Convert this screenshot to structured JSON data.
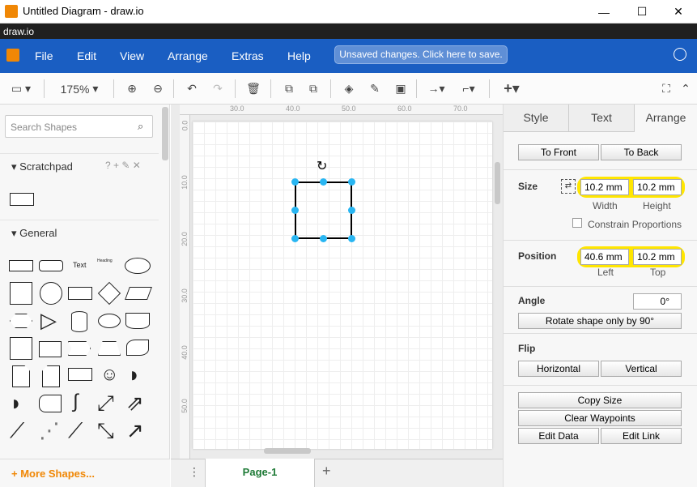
{
  "window": {
    "title": "Untitled Diagram - draw.io",
    "minimize": "—",
    "maximize": "☐",
    "close": "✕"
  },
  "namebar": "draw.io",
  "menu": {
    "file": "File",
    "edit": "Edit",
    "view": "View",
    "arrange": "Arrange",
    "extras": "Extras",
    "help": "Help",
    "unsaved": "Unsaved changes. Click here to save."
  },
  "toolbar": {
    "zoom": "175%"
  },
  "sidebar": {
    "search_placeholder": "Search Shapes",
    "scratchpad": "Scratchpad",
    "scratchpad_icons": "? + ✎ ✕",
    "general": "General",
    "shape_text": "Text",
    "shape_heading": "Heading",
    "more_shapes": "+ More Shapes..."
  },
  "ruler": {
    "top": [
      "30.0",
      "40.0",
      "50.0",
      "60.0",
      "70.0"
    ],
    "left": [
      "0.0",
      "10.0",
      "20.0",
      "30.0",
      "40.0",
      "50.0"
    ]
  },
  "pages": {
    "tab": "Page-1",
    "add": "+"
  },
  "panel": {
    "tabs": {
      "style": "Style",
      "text": "Text",
      "arrange": "Arrange"
    },
    "to_front": "To Front",
    "to_back": "To Back",
    "size_label": "Size",
    "width_value": "10.2 mm",
    "height_value": "10.2 mm",
    "width_label": "Width",
    "height_label": "Height",
    "constrain": "Constrain Proportions",
    "position_label": "Position",
    "left_value": "40.6 mm",
    "top_value": "10.2 mm",
    "left_label": "Left",
    "top_label": "Top",
    "angle_label": "Angle",
    "angle_value": "0°",
    "rotate": "Rotate shape only by 90°",
    "flip_label": "Flip",
    "horizontal": "Horizontal",
    "vertical": "Vertical",
    "copy_size": "Copy Size",
    "clear_waypoints": "Clear Waypoints",
    "edit_data": "Edit Data",
    "edit_link": "Edit Link"
  },
  "colors": {
    "menubar": "#1a5ec2",
    "accent": "#f08705",
    "selection": "#29b6f2",
    "highlight": "#ffe600"
  }
}
